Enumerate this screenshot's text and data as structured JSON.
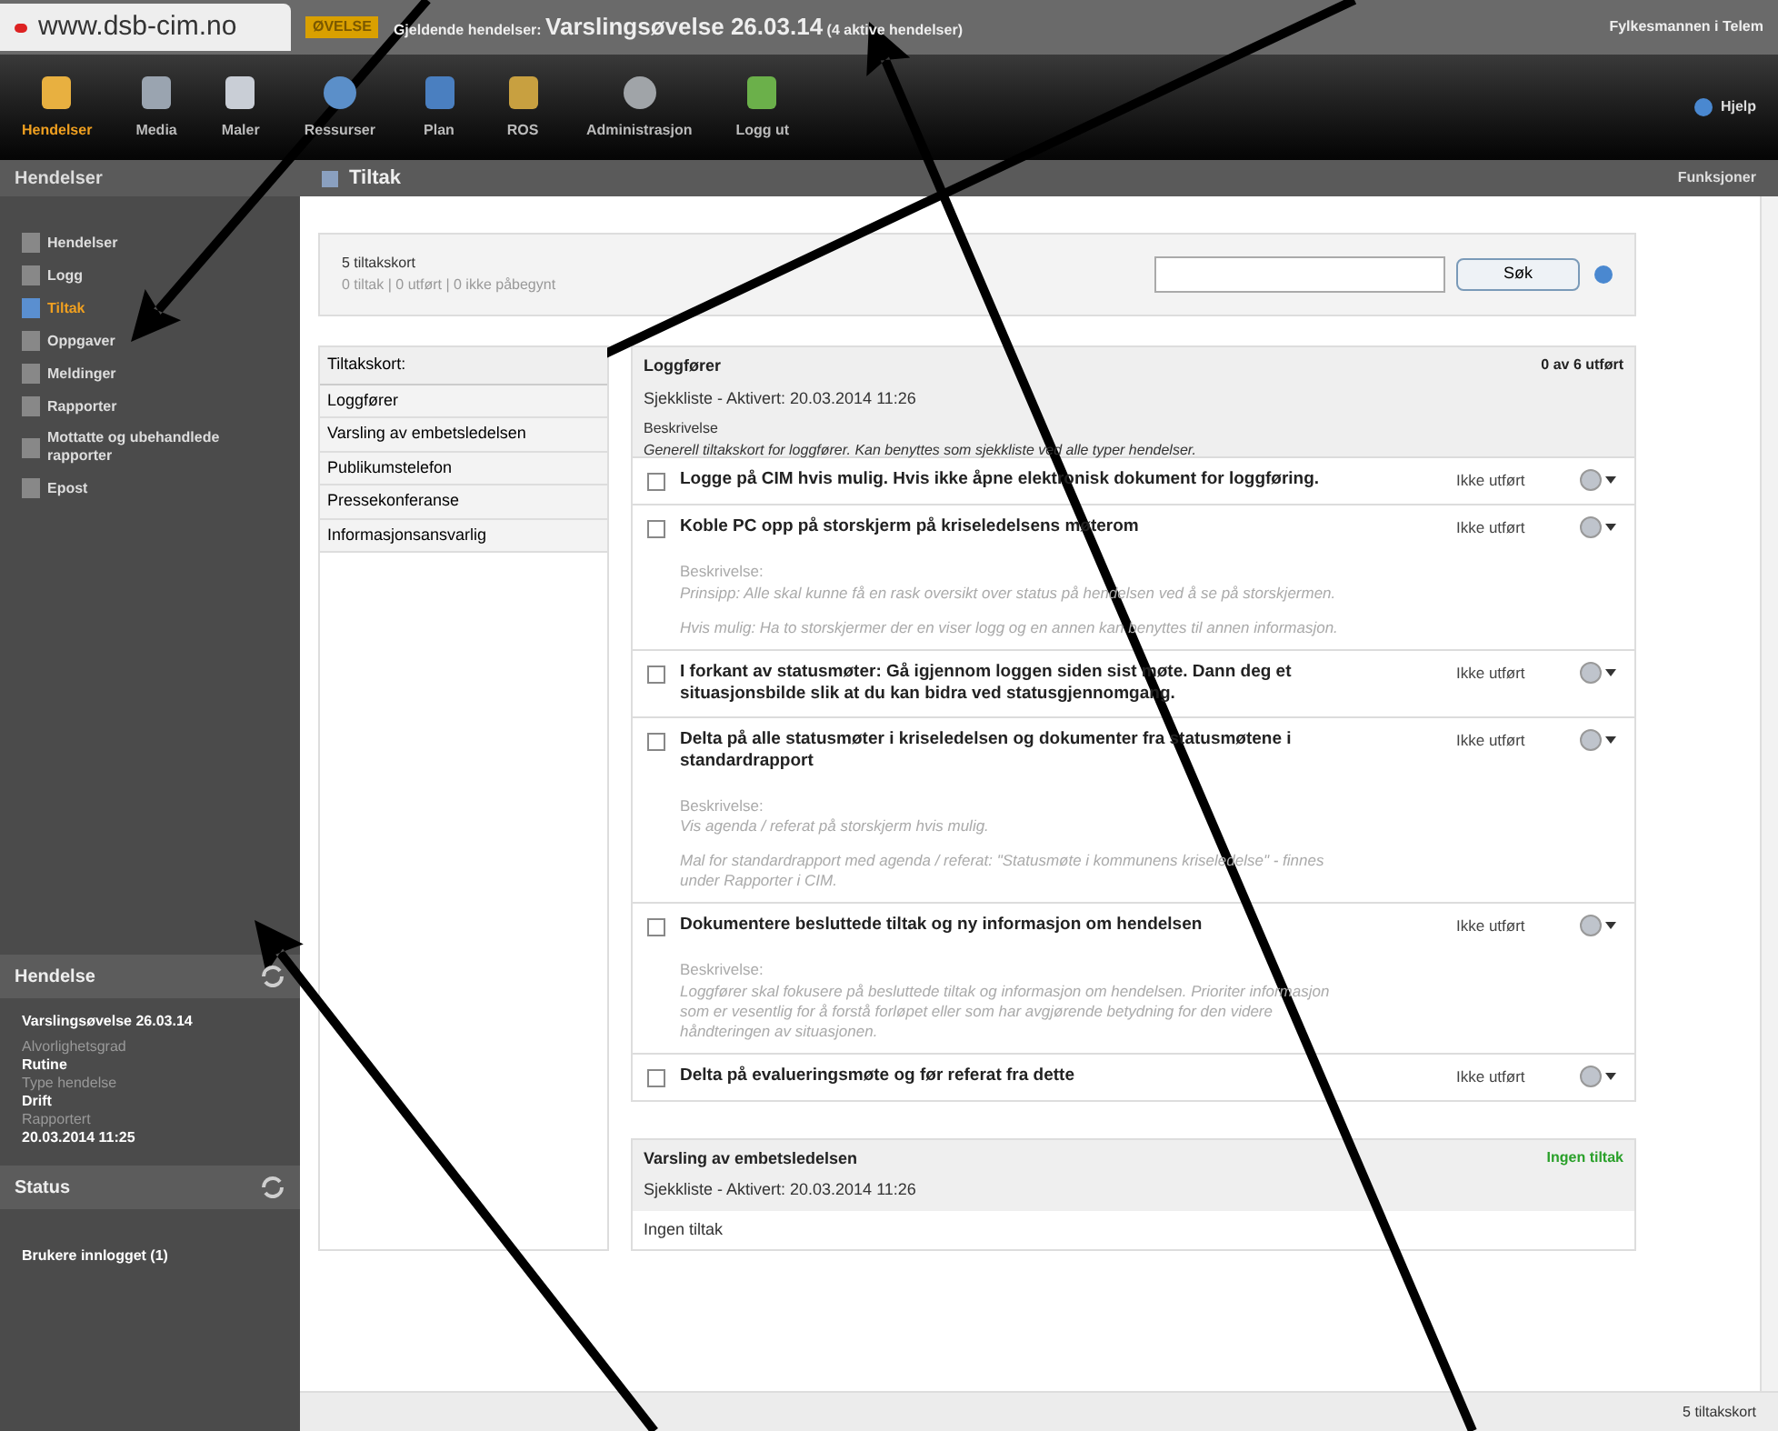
{
  "top_bar": {
    "url": "www.dsb-cim.no",
    "badge": "ØVELSE",
    "title_prefix": "Gjeldende hendelser:",
    "title": "Varslingsøvelse 26.03.14",
    "title_suffix": "(4 aktive hendelser)",
    "user": "Fylkesmannen i Telem"
  },
  "toolbar": {
    "items": [
      {
        "label": "Hendelser",
        "selected": true
      },
      {
        "label": "Media",
        "selected": false
      },
      {
        "label": "Maler",
        "selected": false
      },
      {
        "label": "Ressurser",
        "selected": false
      },
      {
        "label": "Plan",
        "selected": false
      },
      {
        "label": "ROS",
        "selected": false
      },
      {
        "label": "Administrasjon",
        "selected": false
      },
      {
        "label": "Logg ut",
        "selected": false
      }
    ],
    "help": "Hjelp"
  },
  "sidebar": {
    "title": "Hendelser",
    "items": [
      {
        "label": "Hendelser",
        "selected": false
      },
      {
        "label": "Logg",
        "selected": false
      },
      {
        "label": "Tiltak",
        "selected": true
      },
      {
        "label": "Oppgaver",
        "selected": false
      },
      {
        "label": "Meldinger",
        "selected": false
      },
      {
        "label": "Rapporter",
        "selected": false
      },
      {
        "label": "Mottatte og ubehandlede rapporter",
        "selected": false
      },
      {
        "label": "Epost",
        "selected": false
      }
    ],
    "event_panel": {
      "title": "Hendelse",
      "name": "Varslingsøvelse 26.03.14",
      "fields": [
        {
          "label": "Alvorlighetsgrad",
          "value": "Rutine"
        },
        {
          "label": "Type hendelse",
          "value": "Drift"
        },
        {
          "label": "Rapportert",
          "value": "20.03.2014 11:25"
        }
      ]
    },
    "status_panel": {
      "title": "Status",
      "text": "Brukere innlogget (1)"
    }
  },
  "main": {
    "title": "Tiltak",
    "functions": "Funksjoner",
    "summary": {
      "title": "5 tiltakskort",
      "stats": "0 tiltak | 0 utført | 0 ikke påbegynt"
    },
    "search": {
      "button": "Søk"
    },
    "cards_list": {
      "heading": "Tiltakskort:",
      "items": [
        "Loggfører",
        "Varsling av embetsledelsen",
        "Publikumstelefon",
        "Pressekonferanse",
        "Informasjonsansvarlig"
      ]
    },
    "cards": [
      {
        "kind": "checklist",
        "title": "Loggfører",
        "progress": "0 av 6 utført",
        "subtitle": "Sjekkliste - Aktivert: 20.03.2014 11:26",
        "desc_label": "Beskrivelse",
        "desc": "Generell tiltakskort for loggfører. Kan benyttes som sjekkliste ved alle typer hendelser.",
        "tasks": [
          {
            "text": "Logge på CIM hvis mulig. Hvis ikke åpne elektronisk dokument for loggføring.",
            "status": "Ikke utført",
            "checked": false
          },
          {
            "text": "Koble PC opp på storskjerm på kriseledelsens møterom",
            "status": "Ikke utført",
            "checked": false,
            "desc_label": "Beskrivelse:",
            "desc": [
              "Prinsipp: Alle skal kunne få en rask oversikt over status på hendelsen ved å se på storskjermen.",
              "Hvis mulig: Ha to storskjermer der en viser logg og en annen kan benyttes til annen informasjon."
            ]
          },
          {
            "text": "I forkant av statusmøter: Gå igjennom loggen siden sist møte. Dann deg et situasjonsbilde slik at du kan bidra ved statusgjennomgang.",
            "status": "Ikke utført",
            "checked": false
          },
          {
            "text": "Delta på alle statusmøter i kriseledelsen og dokumenter fra statusmøtene i standardrapport",
            "status": "Ikke utført",
            "checked": false,
            "desc_label": "Beskrivelse:",
            "desc": [
              "Vis agenda / referat på storskjerm hvis mulig.",
              "Mal for standardrapport med agenda / referat: \"Statusmøte i kommunens kriseledelse\" - finnes under Rapporter i CIM."
            ]
          },
          {
            "text": "Dokumentere besluttede tiltak og ny informasjon om hendelsen",
            "status": "Ikke utført",
            "checked": false,
            "desc_label": "Beskrivelse:",
            "desc": [
              "Loggfører skal fokusere på besluttede tiltak og informasjon om hendelsen. Prioriter informasjon som er vesentlig for å forstå forløpet eller som har avgjørende betydning for den videre håndteringen av situasjonen."
            ]
          },
          {
            "text": "Delta på evalueringsmøte og før referat fra dette",
            "status": "Ikke utført",
            "checked": false
          }
        ]
      },
      {
        "kind": "empty",
        "title": "Varsling av embetsledelsen",
        "progress": "Ingen tiltak",
        "subtitle": "Sjekkliste - Aktivert: 20.03.2014 11:26",
        "empty": "Ingen tiltak"
      }
    ]
  },
  "status_bar": {
    "text": "5 tiltakskort"
  }
}
